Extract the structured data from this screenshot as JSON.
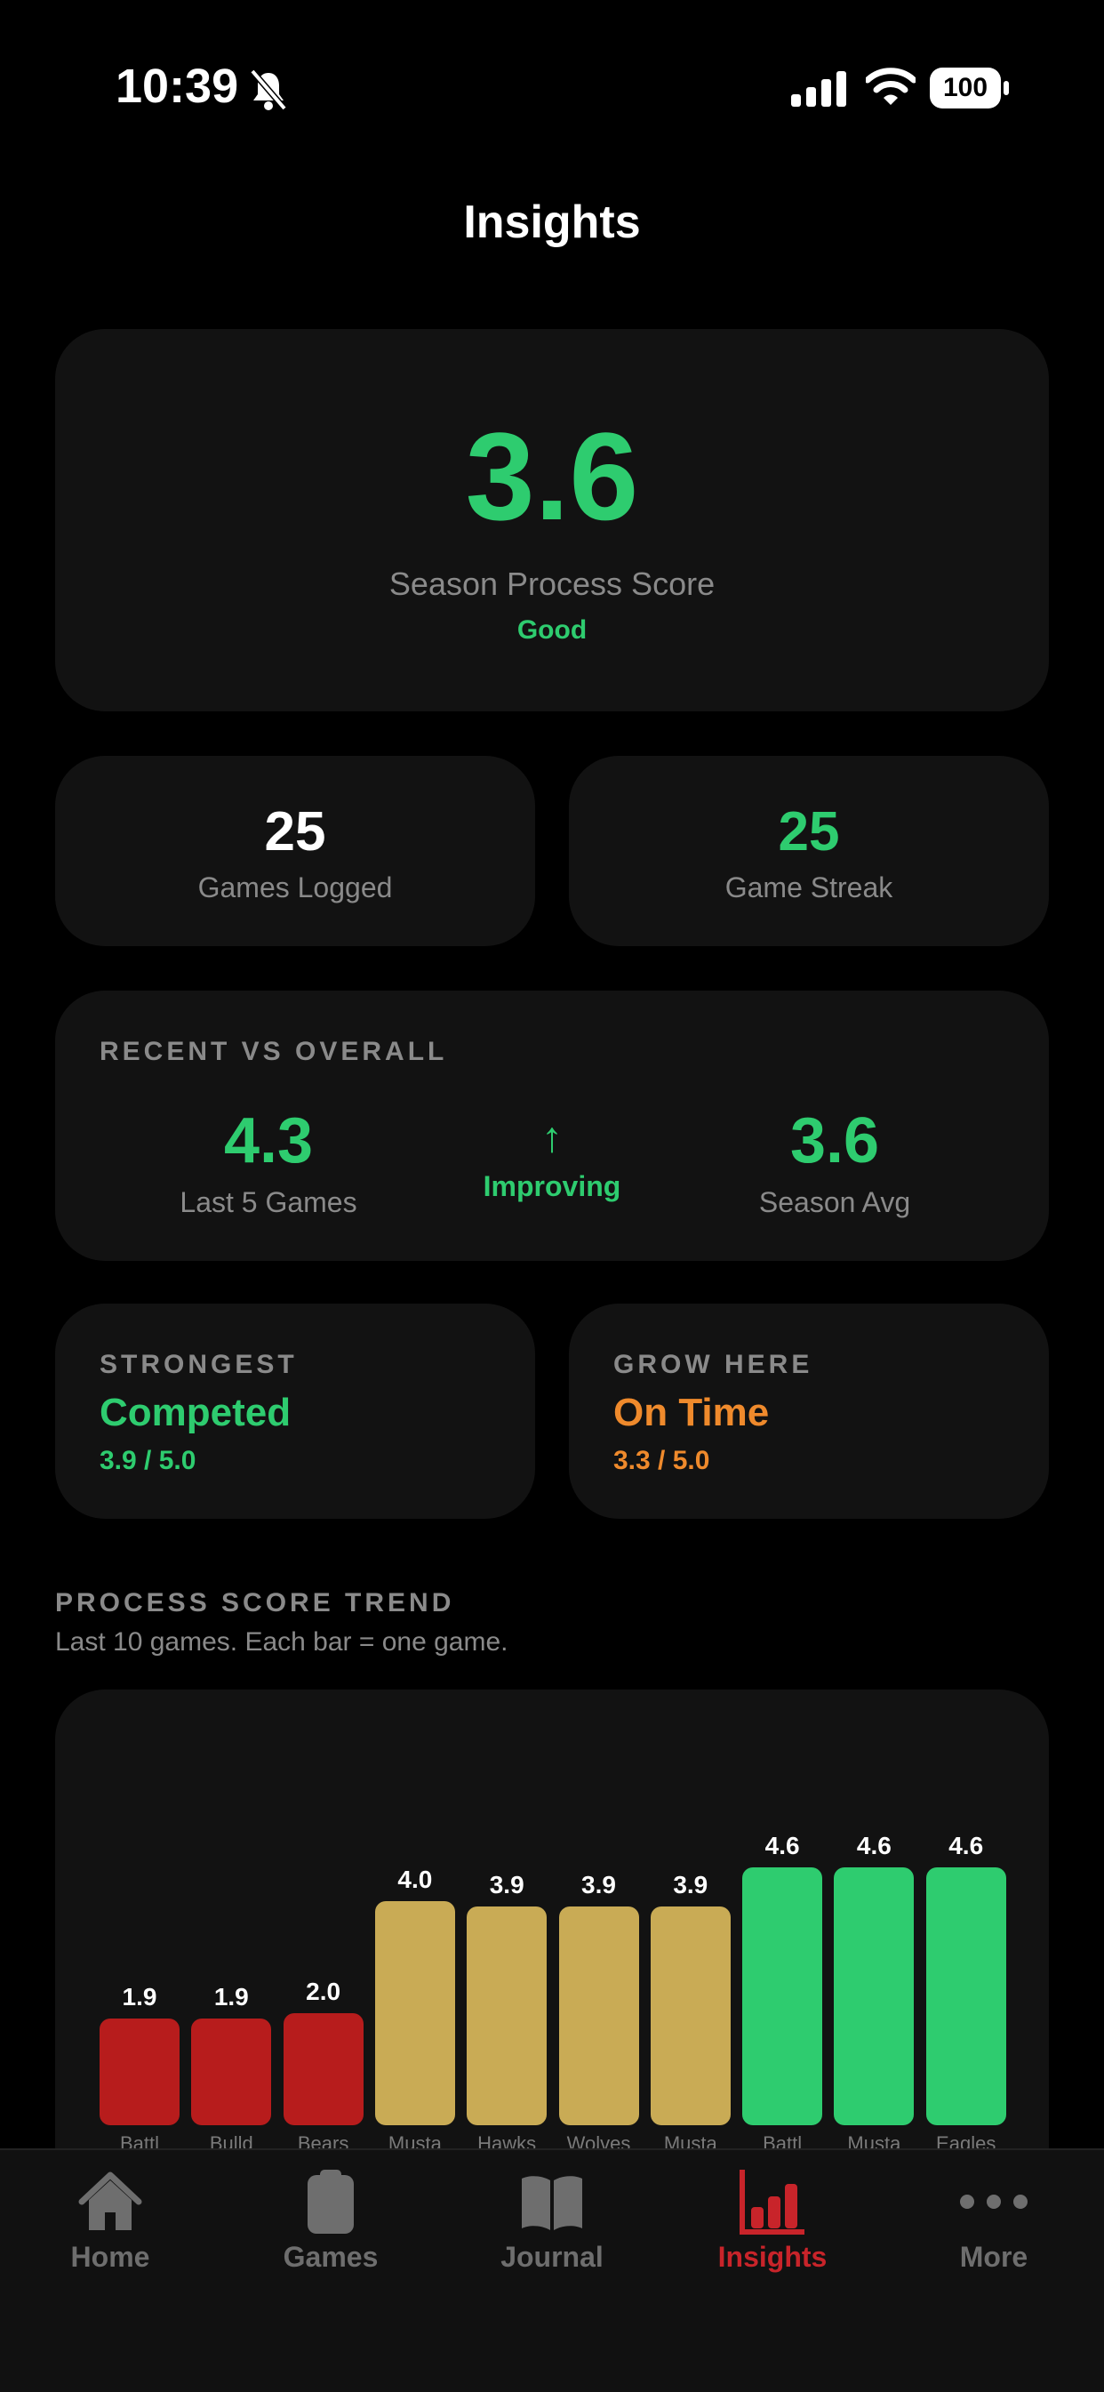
{
  "status_bar": {
    "time": "10:39",
    "battery": "100"
  },
  "header": {
    "title": "Insights"
  },
  "season": {
    "score": "3.6",
    "label": "Season Process Score",
    "rating": "Good"
  },
  "stats": [
    {
      "value": "25",
      "label": "Games Logged"
    },
    {
      "value": "25",
      "label": "Game Streak"
    }
  ],
  "recent": {
    "heading": "RECENT VS OVERALL",
    "recent_value": "4.3",
    "recent_label": "Last 5 Games",
    "trend_arrow": "↑",
    "trend_label": "Improving",
    "season_value": "3.6",
    "season_label": "Season Avg"
  },
  "strongest": {
    "heading": "STRONGEST",
    "name": "Competed",
    "score": "3.9 / 5.0"
  },
  "grow": {
    "heading": "GROW HERE",
    "name": "On Time",
    "score": "3.3 / 5.0"
  },
  "trend": {
    "heading": "PROCESS SCORE TREND",
    "subtitle": "Last 10 games. Each bar = one game."
  },
  "chart_data": {
    "type": "bar",
    "categories": [
      "Battl",
      "Bulld",
      "Bears",
      "Musta",
      "Hawks",
      "Wolves",
      "Musta",
      "Battl",
      "Musta",
      "Eagles"
    ],
    "values": [
      1.9,
      1.9,
      2.0,
      4.0,
      3.9,
      3.9,
      3.9,
      4.6,
      4.6,
      4.6
    ],
    "value_labels": [
      "1.9",
      "1.9",
      "2.0",
      "4.0",
      "3.9",
      "3.9",
      "3.9",
      "4.6",
      "4.6",
      "4.6"
    ],
    "ylim": [
      0,
      5
    ],
    "colors": {
      "low": "#b71c1c",
      "mid": "#c9ab55",
      "high": "#2ecc6f"
    }
  },
  "tabs": [
    {
      "label": "Home",
      "icon": "house-icon"
    },
    {
      "label": "Games",
      "icon": "clipboard-icon"
    },
    {
      "label": "Journal",
      "icon": "book-icon"
    },
    {
      "label": "Insights",
      "icon": "bar-chart-icon",
      "active": true
    },
    {
      "label": "More",
      "icon": "ellipsis-icon"
    }
  ],
  "colors": {
    "accent_green": "#2ecc6f",
    "accent_orange": "#ef8a2c",
    "active_tab": "#c8242a"
  }
}
